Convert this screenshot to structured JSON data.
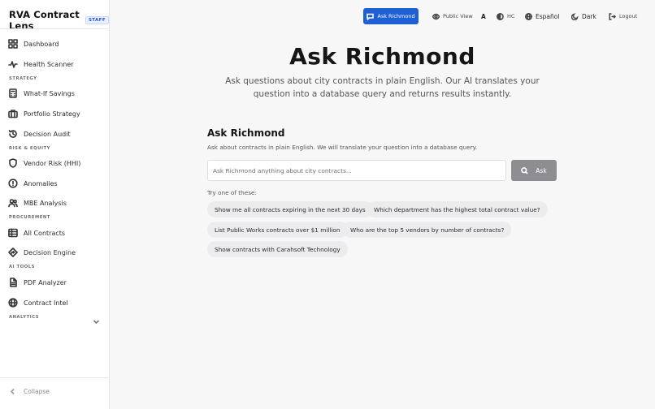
{
  "brand": {
    "name": "RVA Contract Lens",
    "badge": "STAFF"
  },
  "sidebar": {
    "items": [
      {
        "label": "Dashboard",
        "icon": "grid-icon"
      },
      {
        "label": "Health Scanner",
        "icon": "pulse-icon"
      },
      {
        "label": "What-If Savings",
        "icon": "calculator-icon"
      },
      {
        "label": "Portfolio Strategy",
        "icon": "briefcase-icon"
      },
      {
        "label": "Decision Audit",
        "icon": "history-icon"
      },
      {
        "label": "Vendor Risk (HHI)",
        "icon": "shield-icon"
      },
      {
        "label": "Anomalies",
        "icon": "alert-circle-icon"
      },
      {
        "label": "MBE Analysis",
        "icon": "users-icon"
      },
      {
        "label": "All Contracts",
        "icon": "table-icon"
      },
      {
        "label": "Decision Engine",
        "icon": "route-icon"
      },
      {
        "label": "PDF Analyzer",
        "icon": "document-icon"
      },
      {
        "label": "Contract Intel",
        "icon": "globe-icon"
      }
    ],
    "sections": [
      "STRATEGY",
      "RISK & EQUITY",
      "PROCUREMENT",
      "AI TOOLS",
      "ANALYTICS"
    ],
    "collapse_label": "Collapse"
  },
  "topbar": {
    "ask_label": "Ask Richmond",
    "public_view_label": "Public View",
    "font_size_label": "A",
    "contrast_label": "HC",
    "language_label": "Español",
    "theme_label": "Dark",
    "logout_label": "Logout"
  },
  "hero": {
    "title": "Ask Richmond",
    "subtitle": "Ask questions about city contracts in plain English. Our AI translates your question into a database query and returns results instantly."
  },
  "panel": {
    "title": "Ask Richmond",
    "description": "Ask about contracts in plain English. We will translate your question into a database query.",
    "input_placeholder": "Ask Richmond anything about city contracts...",
    "input_value": "",
    "submit_label": "Ask",
    "try_label": "Try one of these:",
    "suggestions": [
      "Show me all contracts expiring in the next 30 days",
      "Which department has the highest total contract value?",
      "List Public Works contracts over $1 million",
      "Who are the top 5 vendors by number of contracts?",
      "Show contracts with Carahsoft Technology"
    ]
  },
  "colors": {
    "accent": "#1f5fd6",
    "submit_disabled": "#8d8d92",
    "chip_bg": "#ececef"
  }
}
